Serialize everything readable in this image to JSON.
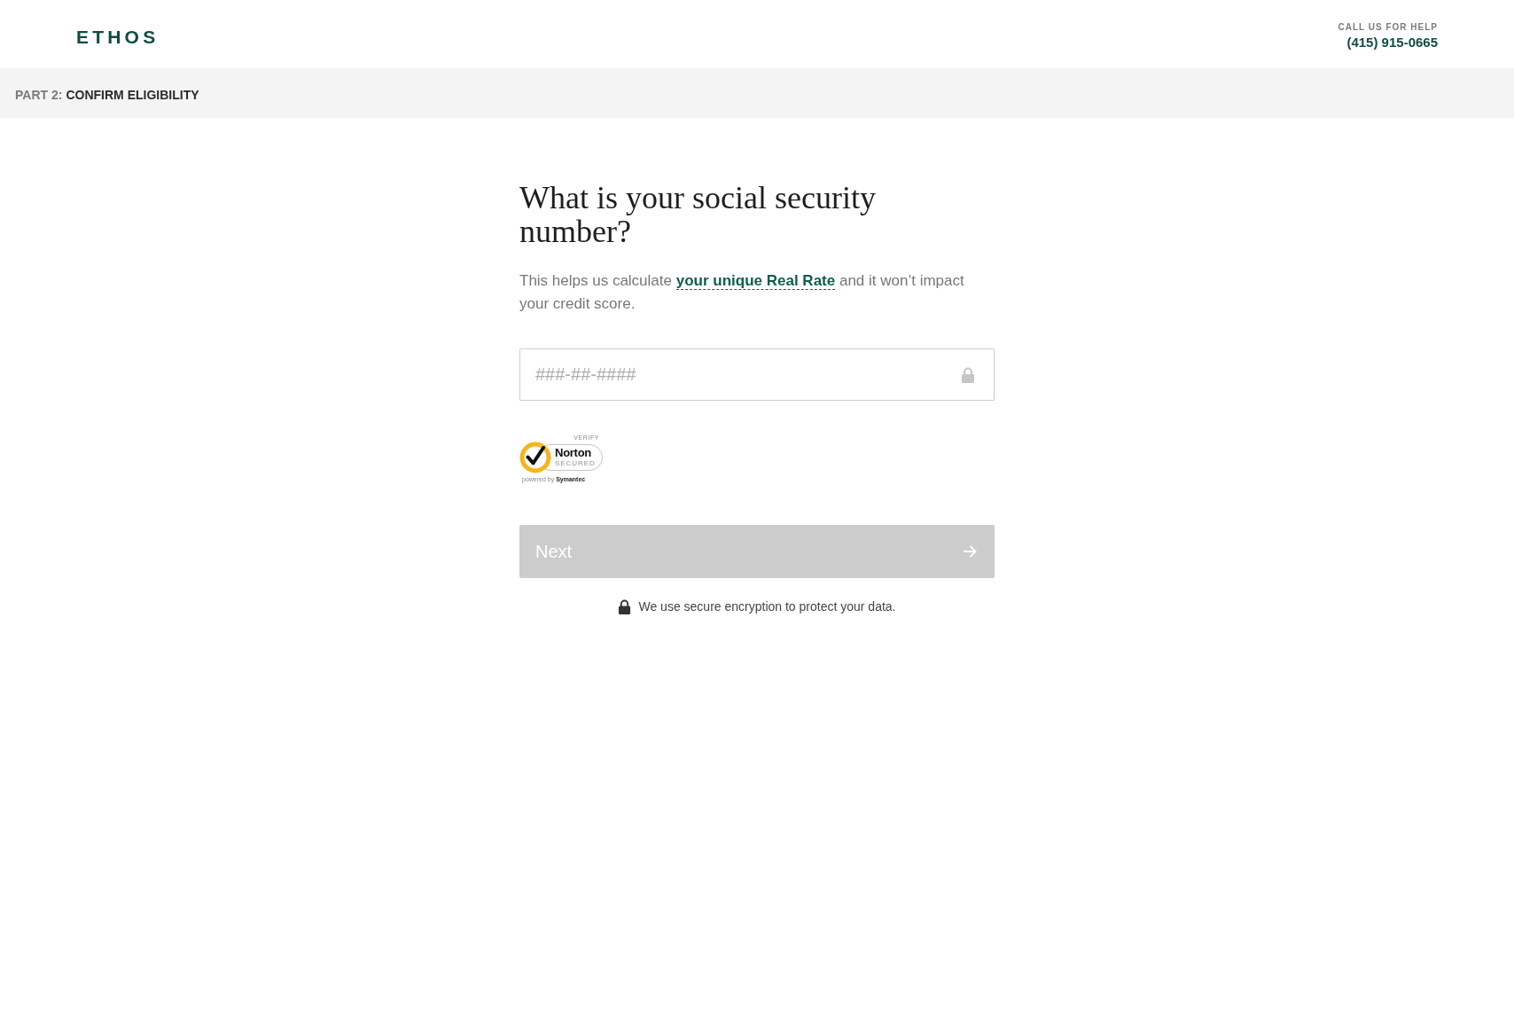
{
  "header": {
    "logo": "ETHOS",
    "help": {
      "label": "CALL US FOR HELP",
      "phone": "(415) 915-0665"
    }
  },
  "step_banner": {
    "part": "PART 2:",
    "title": "CONFIRM ELIGIBILITY"
  },
  "question": {
    "title": "What is your social security number?",
    "description": {
      "text_before": "This helps us calculate",
      "link": "your unique Real Rate",
      "text_after": "and it won’t impact your credit score."
    }
  },
  "ssn_field": {
    "placeholder": "###-##-####"
  },
  "security_seal": {
    "verify": "VERIFY",
    "brand": "Norton",
    "status": "SECURED",
    "powered_by": "powered by",
    "company": "Symantec"
  },
  "next_button": {
    "label": "Next",
    "disabled": true
  },
  "security_note": "We use secure encryption to protect your data."
}
